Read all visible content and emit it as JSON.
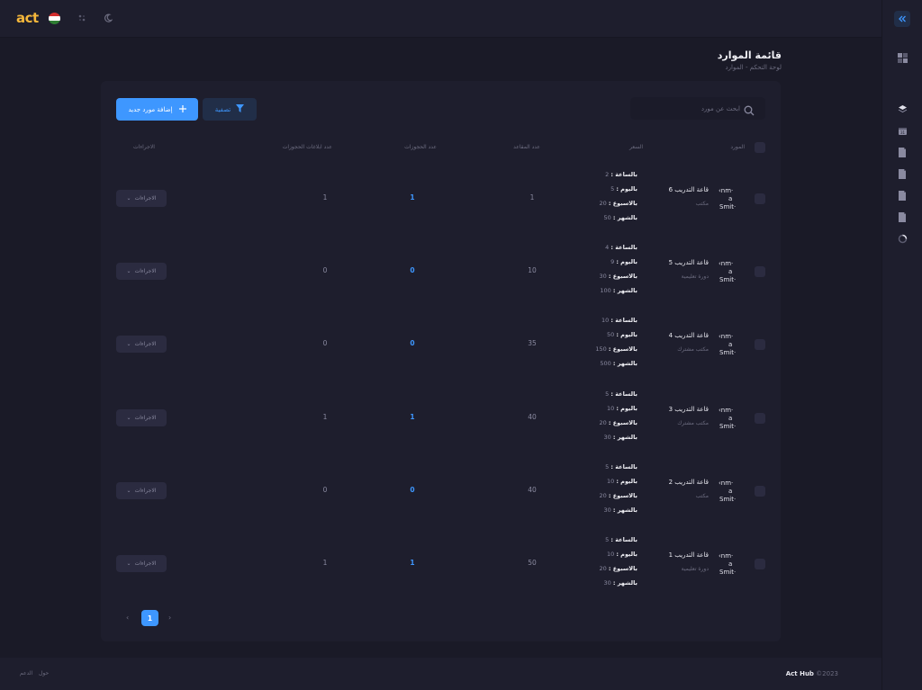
{
  "app": {
    "logo_text": "act",
    "brand": "Act Hub",
    "year": "©2023"
  },
  "header": {
    "title": "قائمة الموارد",
    "breadcrumb_home": "لوحة التحكم",
    "breadcrumb_sep": "-",
    "breadcrumb_current": "الموارد"
  },
  "toolbar": {
    "search_placeholder": "ابحث عن مورد",
    "filter_label": "تصفية",
    "add_label": "إضافة مورد جديد"
  },
  "columns": {
    "resource": "المورد",
    "price": "السعر",
    "seats": "عدد المقاعد",
    "bookings": "عدد الحجوزات",
    "booking_requests": "عدد ابلاغات الحجوزات",
    "actions": "الاجراءات"
  },
  "price_labels": {
    "hour": "بالساعة :",
    "day": "باليوم :",
    "week": "بالاسبوع :",
    "month": "بالشهر :"
  },
  "avatar_text": {
    "line1": "‹nm·",
    "line2": "a",
    "line3": "Smit·"
  },
  "rows": [
    {
      "name": "قاعة التدريب 6",
      "type": "مكتب",
      "hour": "2",
      "day": "5",
      "week": "20",
      "month": "50",
      "seats": "1",
      "bookings": "1",
      "requests": "1",
      "action_label": "الاجراءات"
    },
    {
      "name": "قاعة التدريب 5",
      "type": "دورة تعليمية",
      "hour": "4",
      "day": "9",
      "week": "30",
      "month": "100",
      "seats": "10",
      "bookings": "0",
      "requests": "0",
      "action_label": "الاجراءات"
    },
    {
      "name": "قاعة التدريب 4",
      "type": "مكتب مشترك",
      "hour": "10",
      "day": "50",
      "week": "150",
      "month": "500",
      "seats": "35",
      "bookings": "0",
      "requests": "0",
      "action_label": "الاجراءات"
    },
    {
      "name": "قاعة التدريب 3",
      "type": "مكتب مشترك",
      "hour": "5",
      "day": "10",
      "week": "20",
      "month": "30",
      "seats": "40",
      "bookings": "1",
      "requests": "1",
      "action_label": "الاجراءات"
    },
    {
      "name": "قاعة التدريب 2",
      "type": "مكتب",
      "hour": "5",
      "day": "10",
      "week": "20",
      "month": "30",
      "seats": "40",
      "bookings": "0",
      "requests": "0",
      "action_label": "الاجراءات"
    },
    {
      "name": "قاعة التدريب 1",
      "type": "دورة تعليمية",
      "hour": "5",
      "day": "10",
      "week": "20",
      "month": "30",
      "seats": "50",
      "bookings": "1",
      "requests": "1",
      "action_label": "الاجراءات"
    }
  ],
  "pagination": {
    "current": "1",
    "prev": "‹",
    "next": "›"
  },
  "footer": {
    "link_about": "حول",
    "link_support": "الدعم"
  },
  "icons": {
    "add": "plus-icon",
    "filter": "filter-icon",
    "search": "search-icon",
    "dropdown": "chevron-down-icon"
  },
  "colors": {
    "accent": "#3e97ff",
    "background": "#1a1a27",
    "panel": "#1e1e2d",
    "logo": "#f5b73b"
  }
}
